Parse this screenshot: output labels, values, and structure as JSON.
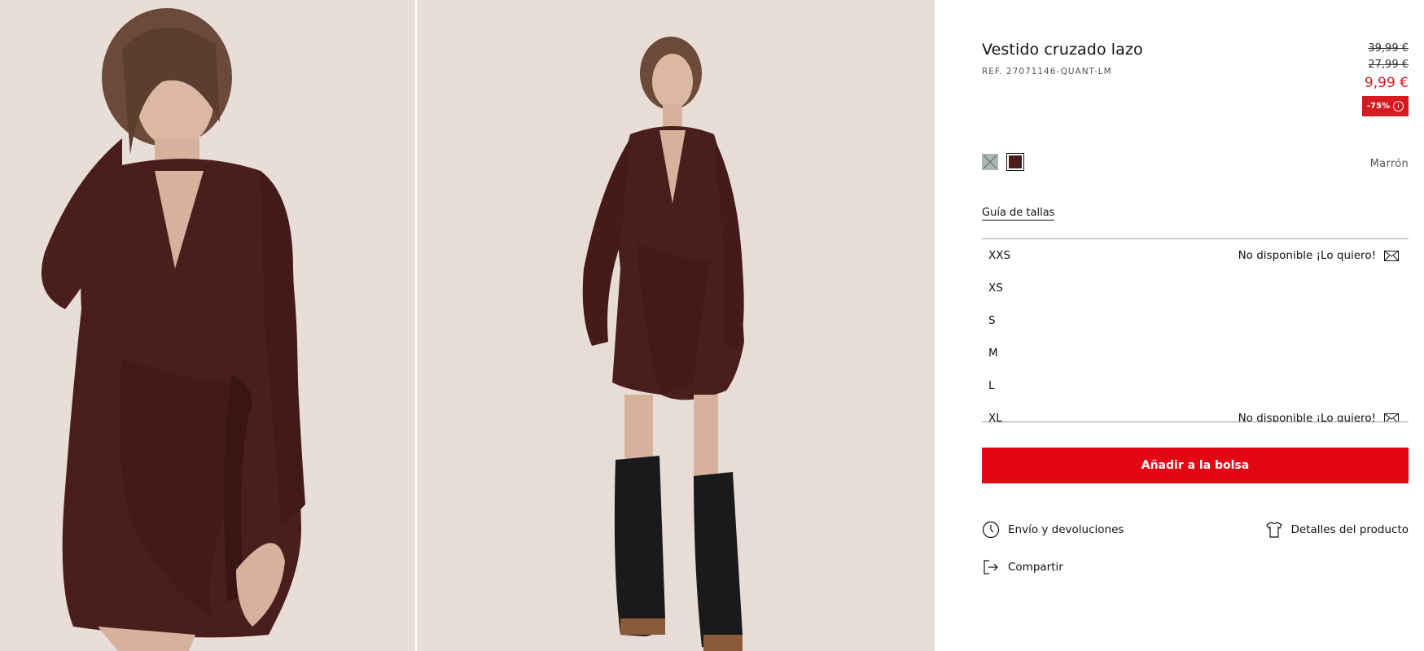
{
  "product": {
    "title": "Vestido cruzado lazo",
    "reference": "REF. 27071146-QUANT-LM"
  },
  "pricing": {
    "original_price": "39,99 €",
    "previous_price": "27,99 €",
    "current_price": "9,99 €",
    "discount_label": "-75%",
    "discount_info_icon": "info-icon"
  },
  "colors": {
    "selected_name": "Marrón",
    "swatches": [
      {
        "name": "unavailable-swatch",
        "hex": "#a9b6b4",
        "available": false
      },
      {
        "name": "brown-swatch",
        "hex": "#4a1e1c",
        "available": true,
        "selected": true
      }
    ]
  },
  "size_guide_label": "Guía de tallas",
  "sizes": [
    {
      "label": "XXS",
      "status": "No disponible ¡Lo quiero!"
    },
    {
      "label": "XS",
      "status": ""
    },
    {
      "label": "S",
      "status": ""
    },
    {
      "label": "M",
      "status": ""
    },
    {
      "label": "L",
      "status": ""
    },
    {
      "label": "XL",
      "status": "No disponible ¡Lo quiero!"
    }
  ],
  "add_to_bag_label": "Añadir a la bolsa",
  "links": {
    "shipping": "Envío y devoluciones",
    "details": "Detalles del producto",
    "share": "Compartir"
  },
  "theme": {
    "accent_red": "#e30613",
    "price_red": "#d71920",
    "dress_color": "#4a1e1c"
  }
}
